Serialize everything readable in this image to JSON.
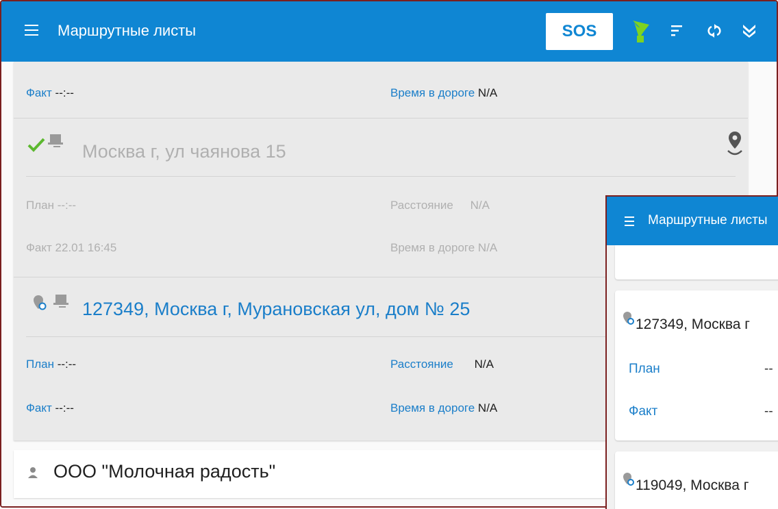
{
  "colors": {
    "appbar": "#0f86d3",
    "accent_blue": "#1a7ec9",
    "check_green": "#5cb82f",
    "gps_green": "#7ed321"
  },
  "appbar": {
    "title": "Маршрутные листы",
    "sos_label": "SOS",
    "icons": [
      "menu-icon",
      "gps-satellite-icon",
      "filter-icon",
      "sync-icon",
      "expand-down-icon"
    ]
  },
  "section0": {
    "fact_label": "Факт",
    "fact_value": "--:--",
    "travel_label": "Время в дороге",
    "travel_value": "N/A"
  },
  "stop1": {
    "address": "Москва г, ул чаянова 15",
    "plan_label": "План",
    "plan_value": "--:--",
    "distance_label": "Расстояние",
    "distance_value": "N/A",
    "fact_label": "Факт",
    "fact_value": "22.01 16:45",
    "travel_label": "Время в дороге",
    "travel_value": "N/A",
    "status": "completed"
  },
  "stop2": {
    "address": "127349, Москва г, Мурановская ул, дом № 25",
    "plan_label": "План",
    "plan_value": "--:--",
    "distance_label": "Расстояние",
    "distance_value": "N/A",
    "fact_label": "Факт",
    "fact_value": "--:--",
    "travel_label": "Время в дороге",
    "travel_value": "N/A"
  },
  "client": {
    "name": "ООО \"Молочная радость\""
  },
  "overlay": {
    "title": "Маршрутные листы",
    "card1": {
      "address": "127349, Москва г",
      "plan_label": "План",
      "plan_value": "--",
      "fact_label": "Факт",
      "fact_value": "--"
    },
    "card2": {
      "address": "119049, Москва г"
    }
  }
}
